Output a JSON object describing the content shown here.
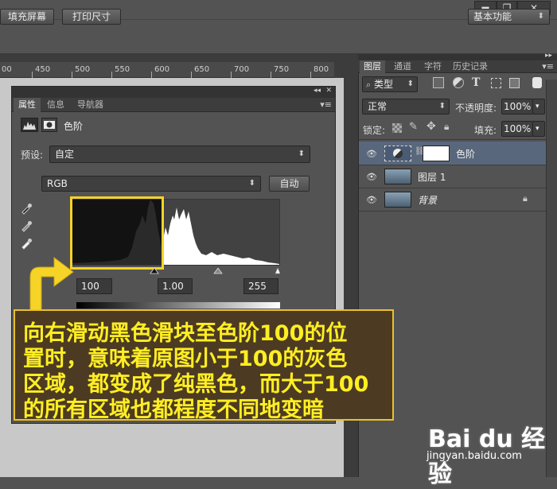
{
  "window": {
    "minimize": "▬",
    "restore": "❐",
    "close": "✕"
  },
  "options_bar": {
    "fill_screen": "填充屏幕",
    "print_size": "打印尺寸",
    "workspace": "基本功能"
  },
  "ruler": {
    "labels": [
      "00",
      "450",
      "500",
      "550",
      "600",
      "650",
      "700",
      "750",
      "800"
    ]
  },
  "properties_panel": {
    "tabs": [
      "属性",
      "信息",
      "导航器"
    ],
    "title": "色阶",
    "preset_label": "预设:",
    "preset_value": "自定",
    "channel_value": "RGB",
    "auto_button": "自动",
    "input_black": "100",
    "input_gamma": "1.00",
    "input_white": "255"
  },
  "layers_panel": {
    "tabs": [
      "图层",
      "通道",
      "字符",
      "历史记录"
    ],
    "filter_kind": "类型",
    "blend_mode": "正常",
    "opacity_label": "不透明度:",
    "opacity_value": "100%",
    "lock_label": "锁定:",
    "fill_label": "填充:",
    "fill_value": "100%",
    "layers": [
      {
        "name": "色阶",
        "selected": true
      },
      {
        "name": "图层 1",
        "selected": false
      },
      {
        "name": "背景",
        "selected": false
      }
    ]
  },
  "callout": {
    "lines": [
      "向右滑动黑色滑块至色阶100的位",
      "置时，意味着原图小于100的灰色",
      "区域，都变成了纯黑色，而大于100",
      "的所有区域也都程度不同地变暗"
    ]
  },
  "watermark": {
    "logo": "Bai du 经验",
    "url": "jingyan.baidu.com"
  },
  "colors": {
    "highlight": "#f6d327",
    "callout_text": "#ffee22",
    "selected_layer": "#59677c"
  }
}
